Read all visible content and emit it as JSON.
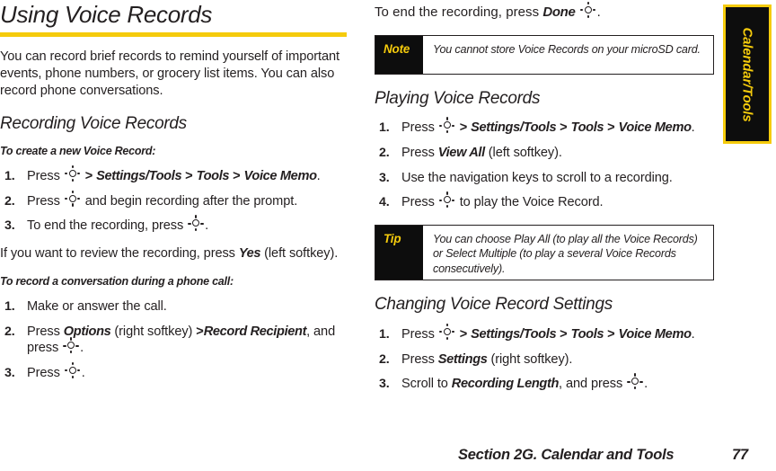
{
  "colors": {
    "accent_yellow": "#f5cb0c",
    "callout_bg": "#0d0d0d",
    "text": "#231f20"
  },
  "thumb_tab": {
    "label": "Calendar/Tools"
  },
  "left_column": {
    "title": "Using Voice Records",
    "intro": "You can record brief records to remind yourself of important events, phone numbers, or grocery list items. You can also record phone conversations.",
    "section_recording": {
      "heading": "Recording Voice Records",
      "subheading": "To create a new Voice Record:",
      "steps": [
        {
          "num": "1.",
          "pre": "Press ",
          "icon": "navigation-key-icon",
          "post_sep": " > ",
          "ui": "Settings/Tools",
          "sep2": " > ",
          "ui2": "Tools",
          "sep3": " > ",
          "ui3": "Voice Memo",
          "tail": "."
        },
        {
          "num": "2.",
          "pre": "Press ",
          "icon": "navigation-key-icon",
          "tail": " and begin recording after the prompt."
        },
        {
          "num": "3.",
          "pre": "To end the recording, press ",
          "icon": "navigation-key-icon",
          "tail": "."
        }
      ],
      "review_note_pre": "If you want to review the recording, press ",
      "review_note_ui": "Yes",
      "review_note_post": " (left softkey)."
    },
    "section_conversation": {
      "subheading": "To record a conversation during a phone call:",
      "steps": [
        {
          "num": "1.",
          "text": "Make or answer the call."
        },
        {
          "num": "2.",
          "pre": "Press ",
          "ui": "Options",
          "mid": " (right softkey) ",
          "sep": ">",
          "ui2": "Record Recipient",
          "post": ", and press ",
          "icon": "navigation-key-icon",
          "tail": "."
        },
        {
          "num": "3.",
          "pre": "Press ",
          "icon": "navigation-key-icon",
          "tail": "."
        }
      ]
    }
  },
  "right_column": {
    "lead_pre": "To end the recording, press ",
    "lead_ui": "Done",
    "lead_icon": "navigation-key-icon",
    "lead_tail": ".",
    "note_callout": {
      "label": "Note",
      "text": "You cannot store Voice Records on your microSD card."
    },
    "section_playing": {
      "heading": "Playing Voice Records",
      "steps": [
        {
          "num": "1.",
          "pre": "Press ",
          "icon": "navigation-key-icon",
          "sep1": " > ",
          "ui": "Settings/Tools",
          "sep2": " > ",
          "ui2": "Tools",
          "sep3": " > ",
          "ui3": "Voice Memo",
          "tail": "."
        },
        {
          "num": "2.",
          "pre": "Press ",
          "ui": "View All",
          "tail": " (left softkey)."
        },
        {
          "num": "3.",
          "text": "Use the navigation keys to scroll to a recording."
        },
        {
          "num": "4.",
          "pre": "Press ",
          "icon": "navigation-key-icon",
          "tail": " to play the Voice Record."
        }
      ]
    },
    "tip_callout": {
      "label": "Tip",
      "text": "You can choose Play All (to play all the Voice Records) or Select Multiple (to play a several Voice Records consecutively)."
    },
    "section_settings": {
      "heading": "Changing Voice Record Settings",
      "steps": [
        {
          "num": "1.",
          "pre": "Press ",
          "icon": "navigation-key-icon",
          "sep1": " > ",
          "ui": "Settings/Tools",
          "sep2": " > ",
          "ui2": "Tools",
          "sep3": " > ",
          "ui3": "Voice Memo",
          "tail": "."
        },
        {
          "num": "2.",
          "pre": "Press ",
          "ui": "Settings",
          "tail": " (right softkey)."
        },
        {
          "num": "3.",
          "pre": "Scroll to ",
          "ui": "Recording Length",
          "post": ", and press ",
          "icon": "navigation-key-icon",
          "tail": "."
        }
      ]
    }
  },
  "footer": {
    "section_text": "Section 2G. Calendar and Tools",
    "page_number": "77"
  }
}
